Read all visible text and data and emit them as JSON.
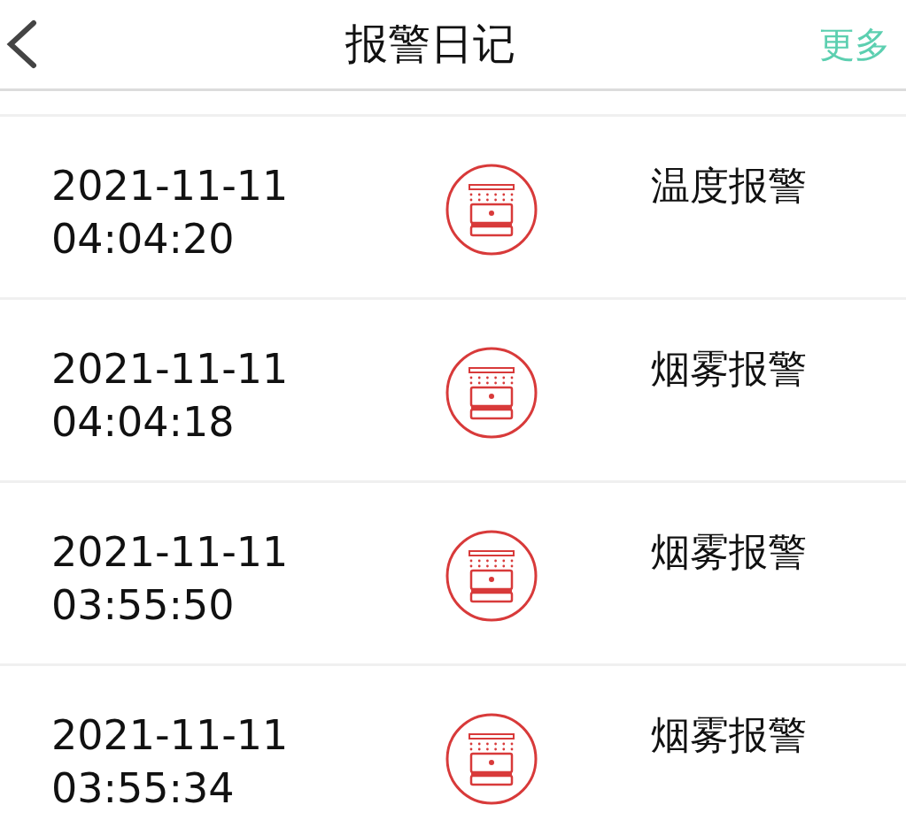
{
  "header": {
    "title": "报警日记",
    "action": "更多"
  },
  "entries": [
    {
      "date": "2021-11-11",
      "time": "04:04:20",
      "type": "温度报警"
    },
    {
      "date": "2021-11-11",
      "time": "04:04:18",
      "type": "烟雾报警"
    },
    {
      "date": "2021-11-11",
      "time": "03:55:50",
      "type": "烟雾报警"
    },
    {
      "date": "2021-11-11",
      "time": "03:55:34",
      "type": "烟雾报警"
    }
  ]
}
